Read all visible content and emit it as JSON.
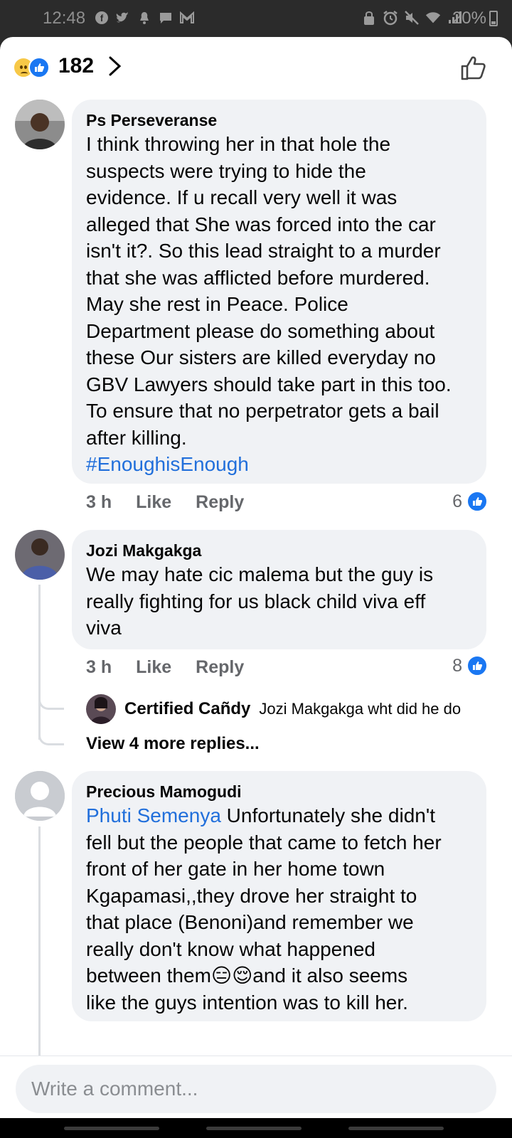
{
  "status_bar": {
    "time": "12:48",
    "battery": "20%",
    "left_icons": [
      "facebook-icon",
      "twitter-icon",
      "notification-icon",
      "chat-icon",
      "gmail-icon"
    ],
    "right_icons": [
      "lock-icon",
      "alarm-icon",
      "mute-icon",
      "wifi-icon",
      "signal-icon"
    ]
  },
  "reactions": {
    "count": "182",
    "types": [
      "sad",
      "like"
    ]
  },
  "comments": [
    {
      "author": "Ps Perseveranse",
      "text": "I think throwing her in that hole the\nsuspects were trying to hide the\nevidence. If u recall very well it was\nalleged that She was forced into the car\nisn't it?. So this lead straight to a murder\nthat she was afflicted before murdered.\nMay she rest in Peace. Police\nDepartment please do something about\nthese Our sisters are killed everyday no\nGBV Lawyers should take part in this too.\nTo ensure that no perpetrator gets a bail\nafter killing.",
      "hashtag": "#EnoughisEnough",
      "time": "3 h",
      "like_label": "Like",
      "reply_label": "Reply",
      "likes": "6"
    },
    {
      "author": "Jozi Makgakga",
      "text": "We may hate cic malema but the guy is\nreally fighting for us black child viva eff\nviva",
      "time": "3 h",
      "like_label": "Like",
      "reply_label": "Reply",
      "likes": "8",
      "reply": {
        "author": "Certified Cañdy",
        "text": "Jozi Makgakga wht did he do"
      },
      "more_replies": "View 4 more replies..."
    },
    {
      "author": "Precious Mamogudi",
      "mention": "Phuti Semenya",
      "text_line1": " Unfortunately she didn't",
      "text": "fell but the people that came to fetch her\nfront of her gate in her home town\nKgapamasi,,they drove her straight to\nthat place (Benoni)and remember we\nreally don't know what happened",
      "text_line_emoji_before": "between them",
      "emojis": "😑😌",
      "text_line_emoji_after": "and it also seems",
      "text_last": "like the guys intention was to kill her."
    }
  ],
  "composer": {
    "placeholder": "Write a comment..."
  }
}
